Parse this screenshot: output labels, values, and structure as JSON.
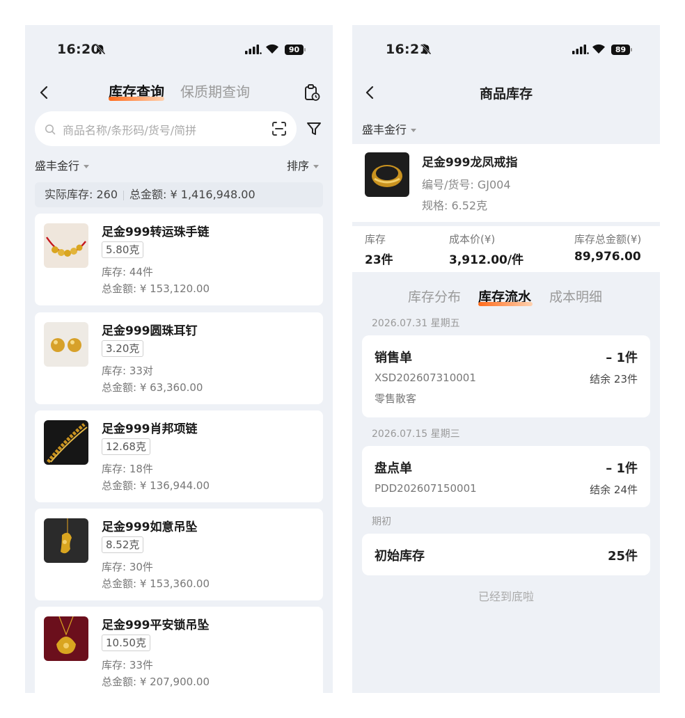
{
  "left": {
    "status": {
      "time": "16:20",
      "battery": "90"
    },
    "tabs": [
      {
        "label": "库存查询",
        "active": true
      },
      {
        "label": "保质期查询",
        "active": false
      }
    ],
    "search": {
      "placeholder": "商品名称/条形码/货号/简拼"
    },
    "store_filter": "盛丰金行",
    "sort_label": "排序",
    "summary": {
      "stock": "实际库存: 260",
      "amount": "总金额: ¥ 1,416,948.00"
    },
    "products": [
      {
        "name": "足金999转运珠手链",
        "weight": "5.80克",
        "stock": "库存:  44件",
        "total": "总金额: ¥ 153,120.00",
        "image": "red-string-bracelet"
      },
      {
        "name": "足金999圆珠耳钉",
        "weight": "3.20克",
        "stock": "库存:  33对",
        "total": "总金额: ¥ 63,360.00",
        "image": "ball-earrings"
      },
      {
        "name": "足金999肖邦项链",
        "weight": "12.68克",
        "stock": "库存:  18件",
        "total": "总金额: ¥ 136,944.00",
        "image": "chain-necklace"
      },
      {
        "name": "足金999如意吊坠",
        "weight": "8.52克",
        "stock": "库存:  30件",
        "total": "总金额: ¥ 153,360.00",
        "image": "ruyi-pendant"
      },
      {
        "name": "足金999平安锁吊坠",
        "weight": "10.50克",
        "stock": "库存:  33件",
        "total": "总金额: ¥ 207,900.00",
        "image": "lock-pendant"
      }
    ]
  },
  "right": {
    "status": {
      "time": "16:21",
      "battery": "89"
    },
    "title": "商品库存",
    "store_filter": "盛丰金行",
    "product": {
      "name": "足金999龙凤戒指",
      "code": "编号/货号:  GJ004",
      "spec": "规格:  6.52克"
    },
    "metrics": [
      {
        "label": "库存",
        "value": "23件"
      },
      {
        "label": "成本价(¥)",
        "value": "3,912.00/件"
      },
      {
        "label": "库存总金额(¥)",
        "value": "89,976.00"
      }
    ],
    "tabs": [
      {
        "label": "库存分布",
        "active": false
      },
      {
        "label": "库存流水",
        "active": true
      },
      {
        "label": "成本明细",
        "active": false
      }
    ],
    "flows": [
      {
        "date": "2026.07.31  星期五",
        "type": "销售单",
        "qty": "– 1件",
        "no": "XSD202607310001",
        "balance": "结余  23件",
        "customer": "零售散客"
      },
      {
        "date": "2026.07.15  星期三",
        "type": "盘点单",
        "qty": "– 1件",
        "no": "PDD202607150001",
        "balance": "结余  24件",
        "customer": ""
      },
      {
        "date": "期初",
        "type": "初始库存",
        "qty": "25件",
        "no": "",
        "balance": "",
        "customer": ""
      }
    ],
    "end_text": "已经到底啦"
  },
  "colors": {
    "accent": "#ff6a1a",
    "background": "#eef1f6",
    "card": "#ffffff"
  }
}
